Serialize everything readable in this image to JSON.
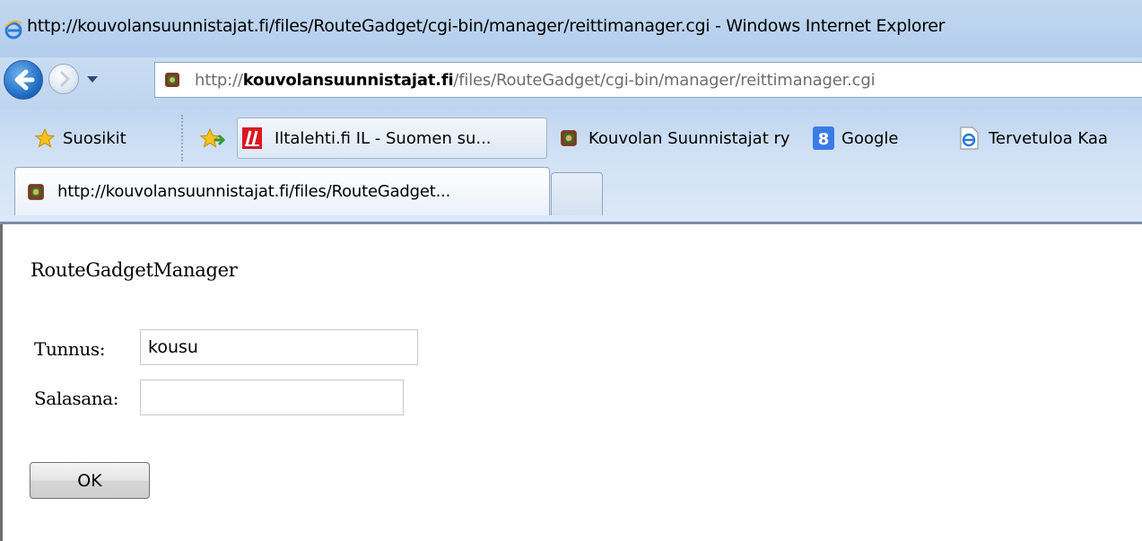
{
  "window": {
    "title": "http://kouvolansuunnistajat.fi/files/RouteGadget/cgi-bin/manager/reittimanager.cgi - Windows Internet Explorer"
  },
  "address_bar": {
    "scheme": "http://",
    "domain": "kouvolansuunnistajat.fi",
    "path": "/files/RouteGadget/cgi-bin/manager/reittimanager.cgi"
  },
  "favorites_bar": {
    "favorites_label": "Suosikit",
    "items": [
      {
        "label": "Iltalehti.fi  IL - Suomen su...",
        "icon": "iltalehti-icon"
      },
      {
        "label": "Kouvolan Suunnistajat ry",
        "icon": "site-favicon"
      },
      {
        "label": "Google",
        "icon": "google-icon"
      },
      {
        "label": "Tervetuloa Kaa",
        "icon": "ie-page-icon"
      }
    ]
  },
  "tabs": [
    {
      "label": "http://kouvolansuunnistajat.fi/files/RouteGadget...",
      "active": true
    }
  ],
  "page": {
    "heading": "RouteGadgetManager",
    "username_label": "Tunnus:",
    "username_value": "kousu",
    "password_label": "Salasana:",
    "password_value": "",
    "submit_label": "OK"
  },
  "colors": {
    "chrome_blue": "#c9ddf3",
    "back_button": "#1f6bc4",
    "iltalehti_red": "#d71920",
    "google_blue": "#3b7be8"
  }
}
